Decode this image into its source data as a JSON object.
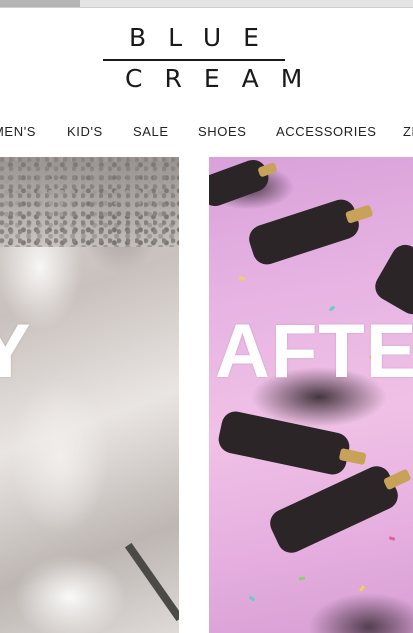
{
  "logo": {
    "line1": "BLUE",
    "line2": "CREAM"
  },
  "nav": {
    "items": [
      "MEN'S",
      "KID'S",
      "SALE",
      "SHOES",
      "ACCESSORIES",
      "ZE"
    ]
  },
  "banners": {
    "left": {
      "text": "Y"
    },
    "right": {
      "text": "AFTE"
    }
  },
  "colors": {
    "accent_text": "#222222",
    "banner_text": "#ffffff",
    "party_pink": "#e7b4e3"
  }
}
